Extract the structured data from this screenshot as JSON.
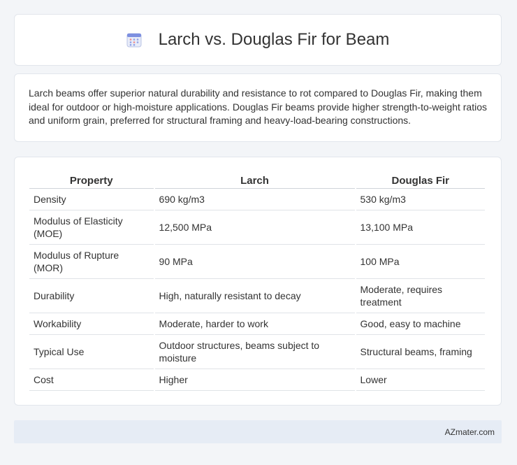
{
  "header": {
    "title": "Larch vs. Douglas Fir for Beam",
    "icon": "calendar-icon"
  },
  "intro": {
    "text": "Larch beams offer superior natural durability and resistance to rot compared to Douglas Fir, making them ideal for outdoor or high-moisture applications. Douglas Fir beams provide higher strength-to-weight ratios and uniform grain, preferred for structural framing and heavy-load-bearing constructions."
  },
  "table": {
    "headers": [
      "Property",
      "Larch",
      "Douglas Fir"
    ],
    "rows": [
      [
        "Density",
        "690 kg/m3",
        "530 kg/m3"
      ],
      [
        "Modulus of Elasticity (MOE)",
        "12,500 MPa",
        "13,100 MPa"
      ],
      [
        "Modulus of Rupture (MOR)",
        "90 MPa",
        "100 MPa"
      ],
      [
        "Durability",
        "High, naturally resistant to decay",
        "Moderate, requires treatment"
      ],
      [
        "Workability",
        "Moderate, harder to work",
        "Good, easy to machine"
      ],
      [
        "Typical Use",
        "Outdoor structures, beams subject to moisture",
        "Structural beams, framing"
      ],
      [
        "Cost",
        "Higher",
        "Lower"
      ]
    ]
  },
  "footer": {
    "brand": "AZmater.com"
  }
}
